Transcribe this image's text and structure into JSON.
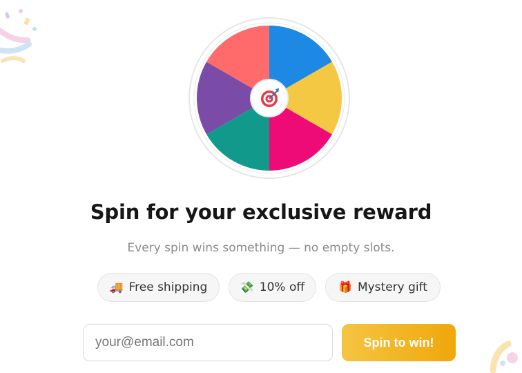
{
  "wheel": {
    "segments": [
      {
        "color": "#1E88E5"
      },
      {
        "color": "#F5C843"
      },
      {
        "color": "#EE0A77"
      },
      {
        "color": "#11998C"
      },
      {
        "color": "#7B4BA8"
      },
      {
        "color": "#FF6B6B"
      }
    ],
    "center_icon": "target-icon"
  },
  "headline": "Spin for your exclusive reward",
  "subtitle": "Every spin wins something — no empty slots.",
  "perks": [
    {
      "emoji": "🚚",
      "icon": "delivery-truck-icon",
      "label": "Free shipping"
    },
    {
      "emoji": "💸",
      "icon": "money-wings-icon",
      "label": "10% off"
    },
    {
      "emoji": "🎁",
      "icon": "gift-icon",
      "label": "Mystery gift"
    }
  ],
  "form": {
    "email_placeholder": "your@email.com",
    "email_value": "",
    "submit_label": "Spin to win!"
  },
  "colors": {
    "button_start": "#F5C542",
    "button_end": "#F0A70A",
    "headline": "#161616",
    "subtitle": "#8A8A8A"
  }
}
